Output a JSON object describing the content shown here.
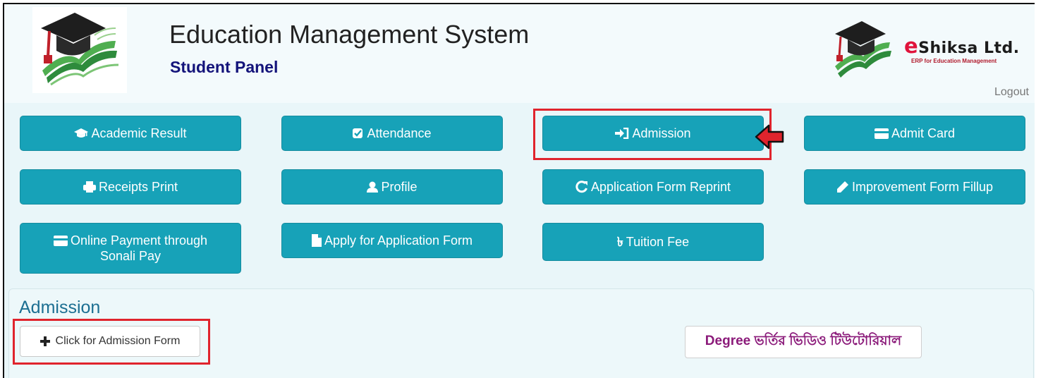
{
  "header": {
    "title": "Education Management System",
    "subtitle": "Student Panel",
    "brand_e": "e",
    "brand_rest": "Shiksa Ltd.",
    "brand_tagline": "ERP for Education Management",
    "logout": "Logout"
  },
  "menu": {
    "academic_result": "Academic Result",
    "attendance": "Attendance",
    "admission": "Admission",
    "admit_card": "Admit Card",
    "receipts_print": "Receipts Print",
    "profile": "Profile",
    "application_form_reprint": "Application Form Reprint",
    "improvement_form_fillup": "Improvement Form Fillup",
    "online_payment_line1": "Online Payment through",
    "online_payment_line2": "Sonali Pay",
    "apply_application_form": "Apply for Application Form",
    "tuition_fee": "Tuition Fee",
    "taka_symbol": "৳"
  },
  "section": {
    "title": "Admission",
    "admission_form_button": "Click for Admission Form",
    "tutorial_button": "Degree ভর্তির ভিডিও টিউটোরিয়াল"
  },
  "colors": {
    "button": "#17a2b8",
    "highlight": "#e0242d",
    "title": "#13137a",
    "section_title": "#1c6f92"
  }
}
